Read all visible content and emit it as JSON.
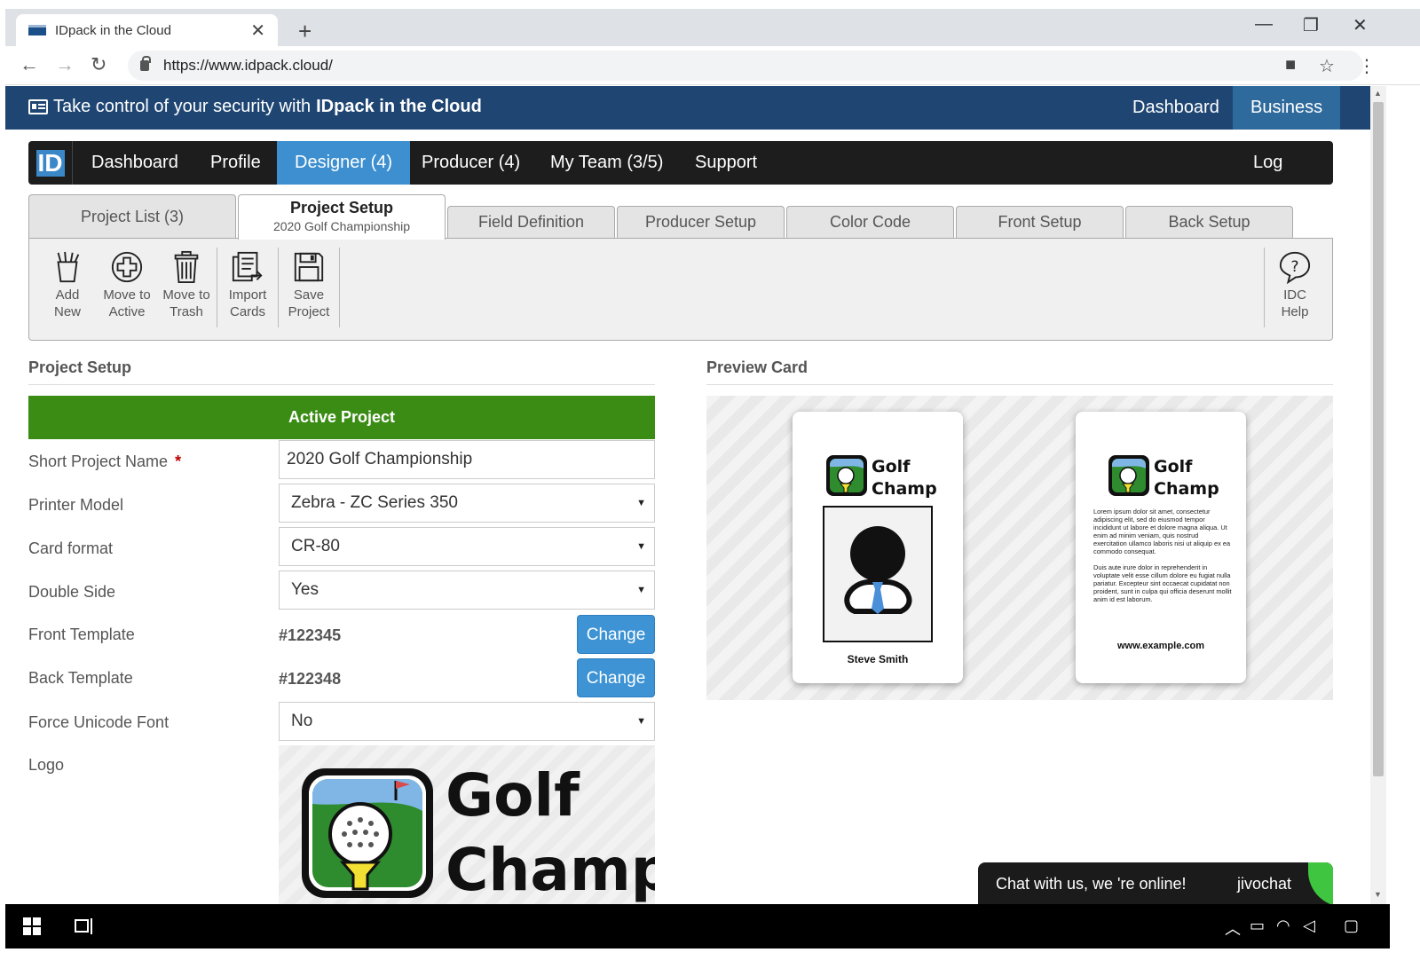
{
  "browser": {
    "tab_title": "IDpack in the Cloud",
    "tab_close": "✕",
    "new_tab": "+",
    "url": "https://www.idpack.cloud/",
    "win_min": "—",
    "win_max": "❐",
    "win_close": "✕"
  },
  "topband": {
    "tagline_prefix": "Take control of your security with",
    "tagline_brand": "IDpack in the Cloud",
    "links": [
      "Dashboard",
      "Business"
    ]
  },
  "mainnav": {
    "logo": "ID",
    "items": [
      "Dashboard",
      "Profile",
      "Designer (4)",
      "Producer (4)",
      "My Team (3/5)",
      "Support"
    ],
    "logout": "Log Out"
  },
  "subtabs": {
    "project_list": "Project List (3)",
    "current_title": "Project Setup",
    "current_sub": "2020 Golf Championship",
    "others": [
      "Field Definition",
      "Producer Setup",
      "Color Code",
      "Front Setup",
      "Back Setup"
    ]
  },
  "toolbar": {
    "add_new": [
      "Add",
      "New"
    ],
    "move_active": [
      "Move to",
      "Active"
    ],
    "move_trash": [
      "Move to",
      "Trash"
    ],
    "import_cards": [
      "Import",
      "Cards"
    ],
    "save_project": [
      "Save",
      "Project"
    ],
    "idc_help": [
      "IDC",
      "Help"
    ]
  },
  "form": {
    "section_title": "Project Setup",
    "banner": "Active Project",
    "labels": {
      "short_name": "Short Project Name",
      "required_mark": "*",
      "printer": "Printer Model",
      "card_format": "Card format",
      "double_side": "Double Side",
      "front_template": "Front Template",
      "back_template": "Back Template",
      "unicode": "Force Unicode Font",
      "logo": "Logo"
    },
    "values": {
      "short_name": "2020 Golf Championship",
      "printer": "Zebra - ZC Series 350",
      "card_format": "CR-80",
      "double_side": "Yes",
      "front_template": "#122345",
      "back_template": "#122348",
      "unicode": "No"
    },
    "change_label": "Change"
  },
  "logo": {
    "line1": "Golf",
    "line2": "Champ"
  },
  "preview": {
    "section_title": "Preview Card",
    "front_name": "Steve Smith",
    "back_text_1": "Lorem ipsum dolor sit amet, consectetur adipiscing elit, sed do eiusmod tempor incididunt ut labore et dolore magna aliqua. Ut enim ad minim veniam, quis nostrud exercitation ullamco laboris nisi ut aliquip ex ea commodo consequat.",
    "back_text_2": "Duis aute irure dolor in reprehenderit in voluptate velit esse cillum dolore eu fugiat nulla pariatur. Excepteur sint occaecat cupidatat non proident, sunt in culpa qui officia deserunt mollit anim id est laborum.",
    "back_url": "www.example.com"
  },
  "chat": {
    "message": "Chat with us, we 're online!",
    "brand": "jivochat"
  },
  "colors": {
    "topband": "#1f4673",
    "nav": "#1d1d1d",
    "nav_active": "#3d8fd0",
    "banner": "#3b8c15",
    "button": "#3d93d4"
  }
}
